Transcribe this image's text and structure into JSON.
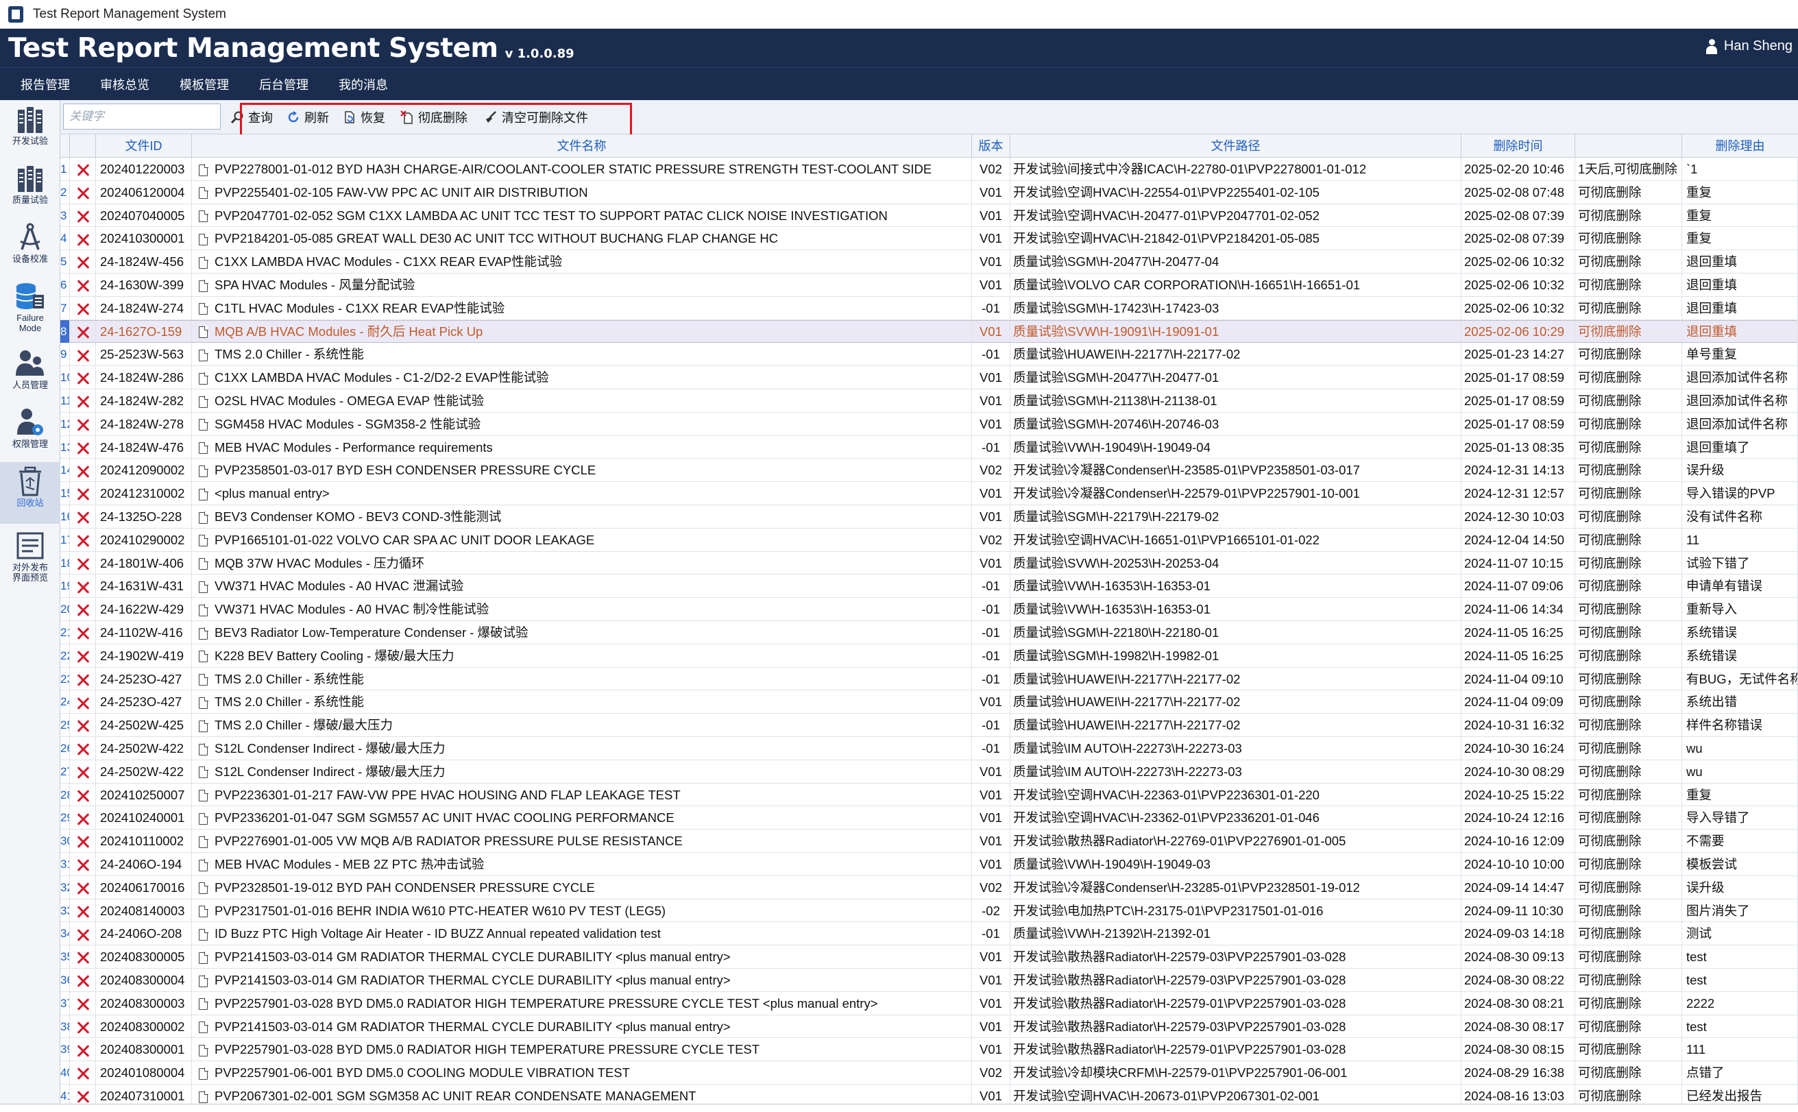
{
  "window": {
    "title": "Test Report Management System"
  },
  "header": {
    "app_title": "Test Report Management System",
    "version": "v 1.0.0.89",
    "user": "Han Sheng"
  },
  "menu": [
    "报告管理",
    "审核总览",
    "模板管理",
    "后台管理",
    "我的消息"
  ],
  "sidebar": [
    {
      "label": "开发试验",
      "icon": "chart-bars-icon"
    },
    {
      "label": "质量试验",
      "icon": "chart-bars-icon"
    },
    {
      "label": "设备校准",
      "icon": "compass-icon"
    },
    {
      "label": "Failure Mode",
      "icon": "database-icon"
    },
    {
      "label": "人员管理",
      "icon": "users-icon"
    },
    {
      "label": "权限管理",
      "icon": "user-gear-icon"
    },
    {
      "label": "回收站",
      "icon": "recycle-bin-icon",
      "active": true
    },
    {
      "label": "对外发布界面预览",
      "icon": "preview-icon"
    }
  ],
  "toolbar": {
    "keyword_placeholder": "关键字",
    "buttons": [
      {
        "label": "查询",
        "icon": "search-icon"
      },
      {
        "label": "刷新",
        "icon": "refresh-icon"
      },
      {
        "label": "恢复",
        "icon": "restore-icon"
      },
      {
        "label": "彻底删除",
        "icon": "delete-permanently-icon"
      },
      {
        "label": "清空可删除文件",
        "icon": "clear-broom-icon"
      }
    ]
  },
  "table": {
    "columns": [
      "文件ID",
      "文件名称",
      "版本",
      "文件路径",
      "删除时间",
      "",
      "删除理由"
    ],
    "rows": [
      [
        "202401220003",
        "PVP2278001-01-012 BYD HA3H CHARGE-AIR/COOLANT-COOLER STATIC PRESSURE STRENGTH TEST-COOLANT SIDE",
        "V02",
        "开发试验\\间接式中冷器ICAC\\H-22780-01\\PVP2278001-01-012",
        "2025-02-20 10:46",
        "1天后,可彻底删除",
        "`1"
      ],
      [
        "202406120004",
        "PVP2255401-02-105 FAW-VW PPC AC UNIT AIR DISTRIBUTION",
        "V01",
        "开发试验\\空调HVAC\\H-22554-01\\PVP2255401-02-105",
        "2025-02-08 07:48",
        "可彻底删除",
        "重复"
      ],
      [
        "202407040005",
        "PVP2047701-02-052 SGM C1XX LAMBDA AC UNIT TCC TEST TO SUPPORT PATAC CLICK NOISE INVESTIGATION",
        "V01",
        "开发试验\\空调HVAC\\H-20477-01\\PVP2047701-02-052",
        "2025-02-08 07:39",
        "可彻底删除",
        "重复"
      ],
      [
        "202410300001",
        "PVP2184201-05-085 GREAT WALL DE30 AC UNIT TCC WITHOUT BUCHANG FLAP CHANGE HC",
        "V01",
        "开发试验\\空调HVAC\\H-21842-01\\PVP2184201-05-085",
        "2025-02-08 07:39",
        "可彻底删除",
        "重复"
      ],
      [
        "24-1824W-456",
        "C1XX LAMBDA HVAC Modules - C1XX REAR EVAP性能试验",
        "V01",
        "质量试验\\SGM\\H-20477\\H-20477-04",
        "2025-02-06 10:32",
        "可彻底删除",
        "退回重填"
      ],
      [
        "24-1630W-399",
        "SPA HVAC Modules - 风量分配试验",
        "V01",
        "质量试验\\VOLVO CAR CORPORATION\\H-16651\\H-16651-01",
        "2025-02-06 10:32",
        "可彻底删除",
        "退回重填"
      ],
      [
        "24-1824W-274",
        "C1TL HVAC Modules - C1XX REAR EVAP性能试验",
        "-01",
        "质量试验\\SGM\\H-17423\\H-17423-03",
        "2025-02-06 10:32",
        "可彻底删除",
        "退回重填"
      ],
      [
        "24-1627O-159",
        "MQB A/B HVAC Modules - 耐久后 Heat Pick Up",
        "V01",
        "质量试验\\SVW\\H-19091\\H-19091-01",
        "2025-02-06 10:29",
        "可彻底删除",
        "退回重填"
      ],
      [
        "25-2523W-563",
        "TMS 2.0 Chiller - 系统性能",
        "-01",
        "质量试验\\HUAWEI\\H-22177\\H-22177-02",
        "2025-01-23 14:27",
        "可彻底删除",
        "单号重复"
      ],
      [
        "24-1824W-286",
        "C1XX LAMBDA HVAC Modules - C1-2/D2-2 EVAP性能试验",
        "V01",
        "质量试验\\SGM\\H-20477\\H-20477-01",
        "2025-01-17 08:59",
        "可彻底删除",
        "退回添加试件名称"
      ],
      [
        "24-1824W-282",
        "O2SL HVAC Modules - OMEGA EVAP 性能试验",
        "V01",
        "质量试验\\SGM\\H-21138\\H-21138-01",
        "2025-01-17 08:59",
        "可彻底删除",
        "退回添加试件名称"
      ],
      [
        "24-1824W-278",
        "SGM458 HVAC Modules - SGM358-2 性能试验",
        "V01",
        "质量试验\\SGM\\H-20746\\H-20746-03",
        "2025-01-17 08:59",
        "可彻底删除",
        "退回添加试件名称"
      ],
      [
        "24-1824W-476",
        "MEB HVAC Modules - Performance requirements",
        "-01",
        "质量试验\\VW\\H-19049\\H-19049-04",
        "2025-01-13 08:35",
        "可彻底删除",
        "退回重填了"
      ],
      [
        "202412090002",
        "PVP2358501-03-017 BYD ESH CONDENSER PRESSURE CYCLE",
        "V02",
        "开发试验\\冷凝器Condenser\\H-23585-01\\PVP2358501-03-017",
        "2024-12-31 14:13",
        "可彻底删除",
        "误升级"
      ],
      [
        "202412310002",
        "<plus manual entry>",
        "V01",
        "开发试验\\冷凝器Condenser\\H-22579-01\\PVP2257901-10-001",
        "2024-12-31 12:57",
        "可彻底删除",
        "导入错误的PVP"
      ],
      [
        "24-1325O-228",
        "BEV3 Condenser KOMO - BEV3 COND-3性能测试",
        "V01",
        "质量试验\\SGM\\H-22179\\H-22179-02",
        "2024-12-30 10:03",
        "可彻底删除",
        "没有试件名称"
      ],
      [
        "202410290002",
        "PVP1665101-01-022 VOLVO CAR SPA AC UNIT DOOR LEAKAGE",
        "V02",
        "开发试验\\空调HVAC\\H-16651-01\\PVP1665101-01-022",
        "2024-12-04 14:50",
        "可彻底删除",
        "11"
      ],
      [
        "24-1801W-406",
        "MQB 37W HVAC Modules - 压力循环",
        "V01",
        "质量试验\\SVW\\H-20253\\H-20253-04",
        "2024-11-07 10:15",
        "可彻底删除",
        "试验下错了"
      ],
      [
        "24-1631W-431",
        "VW371 HVAC Modules - A0 HVAC 泄漏试验",
        "-01",
        "质量试验\\VW\\H-16353\\H-16353-01",
        "2024-11-07 09:06",
        "可彻底删除",
        "申请单有错误"
      ],
      [
        "24-1622W-429",
        "VW371 HVAC Modules - A0 HVAC 制冷性能试验",
        "-01",
        "质量试验\\VW\\H-16353\\H-16353-01",
        "2024-11-06 14:34",
        "可彻底删除",
        "重新导入"
      ],
      [
        "24-1102W-416",
        "BEV3 Radiator Low-Temperature Condenser - 爆破试验",
        "-01",
        "质量试验\\SGM\\H-22180\\H-22180-01",
        "2024-11-05 16:25",
        "可彻底删除",
        "系统错误"
      ],
      [
        "24-1902W-419",
        "K228 BEV Battery Cooling - 爆破/最大压力",
        "-01",
        "质量试验\\SGM\\H-19982\\H-19982-01",
        "2024-11-05 16:25",
        "可彻底删除",
        "系统错误"
      ],
      [
        "24-2523O-427",
        "TMS 2.0 Chiller - 系统性能",
        "-01",
        "质量试验\\HUAWEI\\H-22177\\H-22177-02",
        "2024-11-04 09:10",
        "可彻底删除",
        "有BUG，无试件名称"
      ],
      [
        "24-2523O-427",
        "TMS 2.0 Chiller - 系统性能",
        "V01",
        "质量试验\\HUAWEI\\H-22177\\H-22177-02",
        "2024-11-04 09:09",
        "可彻底删除",
        "系统出错"
      ],
      [
        "24-2502W-425",
        "TMS 2.0 Chiller - 爆破/最大压力",
        "-01",
        "质量试验\\HUAWEI\\H-22177\\H-22177-02",
        "2024-10-31 16:32",
        "可彻底删除",
        "样件名称错误"
      ],
      [
        "24-2502W-422",
        "S12L Condenser Indirect - 爆破/最大压力",
        "-01",
        "质量试验\\IM AUTO\\H-22273\\H-22273-03",
        "2024-10-30 16:24",
        "可彻底删除",
        "wu"
      ],
      [
        "24-2502W-422",
        "S12L Condenser Indirect - 爆破/最大压力",
        "V01",
        "质量试验\\IM AUTO\\H-22273\\H-22273-03",
        "2024-10-30 08:29",
        "可彻底删除",
        "wu"
      ],
      [
        "202410250007",
        "PVP2236301-01-217 FAW-VW PPE HVAC HOUSING AND FLAP LEAKAGE TEST",
        "V01",
        "开发试验\\空调HVAC\\H-22363-01\\PVP2236301-01-220",
        "2024-10-25 15:22",
        "可彻底删除",
        "重复"
      ],
      [
        "202410240001",
        "PVP2336201-01-047 SGM SGM557 AC UNIT HVAC COOLING PERFORMANCE",
        "V01",
        "开发试验\\空调HVAC\\H-23362-01\\PVP2336201-01-046",
        "2024-10-24 12:16",
        "可彻底删除",
        "导入导错了"
      ],
      [
        "202410110002",
        "PVP2276901-01-005 VW MQB A/B RADIATOR PRESSURE PULSE RESISTANCE",
        "V01",
        "开发试验\\散热器Radiator\\H-22769-01\\PVP2276901-01-005",
        "2024-10-16 12:09",
        "可彻底删除",
        "不需要"
      ],
      [
        "24-2406O-194",
        "MEB HVAC Modules - MEB 2Z PTC 热冲击试验",
        "V01",
        "质量试验\\VW\\H-19049\\H-19049-03",
        "2024-10-10 10:00",
        "可彻底删除",
        "模板尝试"
      ],
      [
        "202406170016",
        "PVP2328501-19-012 BYD PAH CONDENSER PRESSURE CYCLE",
        "V02",
        "开发试验\\冷凝器Condenser\\H-23285-01\\PVP2328501-19-012",
        "2024-09-14 14:47",
        "可彻底删除",
        "误升级"
      ],
      [
        "202408140003",
        "PVP2317501-01-016 BEHR INDIA W610 PTC-HEATER W610 PV TEST (LEG5)",
        "-02",
        "开发试验\\电加热PTC\\H-23175-01\\PVP2317501-01-016",
        "2024-09-11 10:30",
        "可彻底删除",
        "图片消失了"
      ],
      [
        "24-2406O-208",
        "ID Buzz PTC High Voltage Air Heater - ID BUZZ Annual repeated validation test",
        "-01",
        "质量试验\\VW\\H-21392\\H-21392-01",
        "2024-09-03 14:18",
        "可彻底删除",
        "测试"
      ],
      [
        "202408300005",
        "PVP2141503-03-014 GM  RADIATOR THERMAL CYCLE DURABILITY <plus manual entry>",
        "V01",
        "开发试验\\散热器Radiator\\H-22579-03\\PVP2257901-03-028",
        "2024-08-30 09:13",
        "可彻底删除",
        "test"
      ],
      [
        "202408300004",
        "PVP2141503-03-014 GM  RADIATOR THERMAL CYCLE DURABILITY <plus manual entry>",
        "V01",
        "开发试验\\散热器Radiator\\H-22579-03\\PVP2257901-03-028",
        "2024-08-30 08:22",
        "可彻底删除",
        "test"
      ],
      [
        "202408300003",
        "PVP2257901-03-028 BYD DM5.0 RADIATOR HIGH TEMPERATURE PRESSURE CYCLE TEST <plus manual entry>",
        "V01",
        "开发试验\\散热器Radiator\\H-22579-01\\PVP2257901-03-028",
        "2024-08-30 08:21",
        "可彻底删除",
        "2222"
      ],
      [
        "202408300002",
        "PVP2141503-03-014 GM  RADIATOR THERMAL CYCLE DURABILITY <plus manual entry>",
        "V01",
        "开发试验\\散热器Radiator\\H-22579-03\\PVP2257901-03-028",
        "2024-08-30 08:17",
        "可彻底删除",
        "test"
      ],
      [
        "202408300001",
        "PVP2257901-03-028 BYD DM5.0 RADIATOR HIGH TEMPERATURE PRESSURE CYCLE TEST",
        "V01",
        "开发试验\\散热器Radiator\\H-22579-01\\PVP2257901-03-028",
        "2024-08-30 08:15",
        "可彻底删除",
        "111"
      ],
      [
        "202401080004",
        "PVP2257901-06-001 BYD DM5.0 COOLING MODULE VIBRATION TEST",
        "V02",
        "开发试验\\冷却模块CRFM\\H-22579-01\\PVP2257901-06-001",
        "2024-08-29 16:38",
        "可彻底删除",
        "点错了"
      ],
      [
        "202407310001",
        "PVP2067301-02-001 SGM SGM358 AC UNIT REAR CONDENSATE MANAGEMENT",
        "V01",
        "开发试验\\空调HVAC\\H-20673-01\\PVP2067301-02-001",
        "2024-08-16 13:03",
        "可彻底删除",
        "已经发出报告"
      ]
    ],
    "selected_row_index": 7
  }
}
